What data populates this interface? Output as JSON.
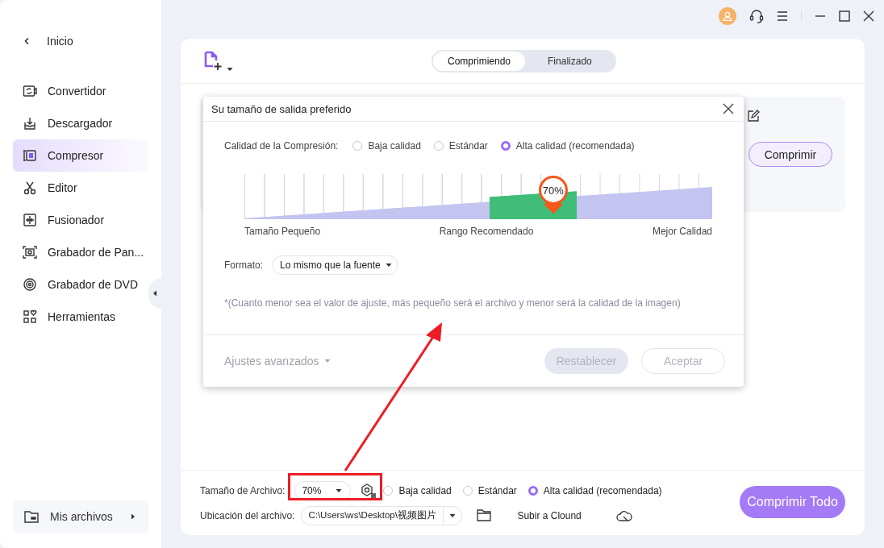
{
  "sidebar": {
    "back": {
      "label": "Inicio"
    },
    "items": [
      {
        "label": "Convertidor",
        "selected": false
      },
      {
        "label": "Descargador",
        "selected": false
      },
      {
        "label": "Compresor",
        "selected": true
      },
      {
        "label": "Editor",
        "selected": false
      },
      {
        "label": "Fusionador",
        "selected": false
      },
      {
        "label": "Grabador de Pan...",
        "selected": false
      },
      {
        "label": "Grabador de DVD",
        "selected": false
      },
      {
        "label": "Herramientas",
        "selected": false
      }
    ],
    "footer": {
      "label": "Mis archivos"
    }
  },
  "tabs": [
    {
      "label": "Comprimiendo",
      "selected": true
    },
    {
      "label": "Finalizado",
      "selected": false
    }
  ],
  "file_item": {
    "button": "Comprimir"
  },
  "dialog": {
    "title": "Su tamaño de salida preferido",
    "quality_label": "Calidad de la Compresión:",
    "quality_options": [
      {
        "label": "Baja calidad",
        "selected": false
      },
      {
        "label": "Estándar",
        "selected": false
      },
      {
        "label": "Alta calidad (recomendada)",
        "selected": true
      }
    ],
    "slider": {
      "level": 0.66,
      "reading": "70%",
      "labels": [
        "Tamaño Pequeño",
        "Rango Recomendado",
        "Mejor Calidad"
      ]
    },
    "format": {
      "label": "Formato:",
      "value": "Lo mismo que la fuente"
    },
    "note": "*(Cuanto menor sea el valor de ajuste, más pequeño será el archivo y menor será la calidad de la imagen)",
    "advanced": "Ajustes avanzados",
    "buttons": [
      {
        "label": "Restablecer",
        "disabled": true,
        "kind": "filled"
      },
      {
        "label": "Aceptar",
        "disabled": true,
        "kind": "outline"
      }
    ]
  },
  "bottom": {
    "size_label": "Tamaño de Archivo:",
    "size_value": "70%",
    "quality_options": [
      {
        "label": "Baja calidad",
        "selected": false
      },
      {
        "label": "Estándar",
        "selected": false
      },
      {
        "label": "Alta calidad (recomendada)",
        "selected": true
      }
    ],
    "location_label": "Ubicación del archivo:",
    "location_value": "C:\\Users\\ws\\Desktop\\视频图片",
    "upload": "Subir a Clound",
    "compress_all": "Comprimir Todo"
  }
}
